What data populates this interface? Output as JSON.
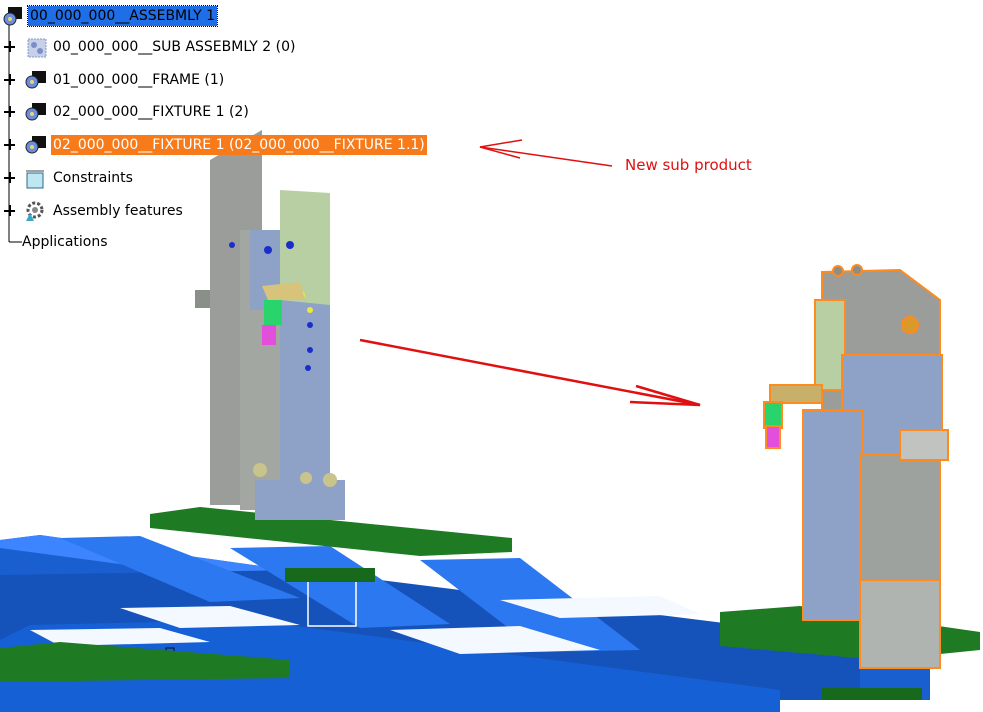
{
  "tree": {
    "root": {
      "label": "00_000_000__ASSEBMLY 1"
    },
    "items": [
      {
        "label": "00_000_000__SUB ASSEBMLY 2 (0)"
      },
      {
        "label": "01_000_000__FRAME (1)"
      },
      {
        "label": "02_000_000__FIXTURE 1 (2)"
      },
      {
        "label": "02_000_000__FIXTURE 1 (02_000_000__FIXTURE 1.1)"
      },
      {
        "label": "Constraints"
      },
      {
        "label": "Assembly features"
      },
      {
        "label": "Applications"
      }
    ]
  },
  "annotation": {
    "text": "New sub product",
    "color": "#e01010"
  },
  "colors": {
    "selection": "#1e6ee8",
    "highlight": "#f87b1b",
    "frame_blue": "#1a5fd0",
    "plate_green": "#1f7a24",
    "fixture_gray": "#9ea29e",
    "fixture_blue": "#8ea2c8",
    "outline_orange": "#ff8a1e"
  },
  "icons": {
    "root": "product-icon",
    "sub_assembly": "component-icon",
    "part": "product-icon",
    "constraints": "constraints-icon",
    "assembly_features": "gear-icon"
  }
}
